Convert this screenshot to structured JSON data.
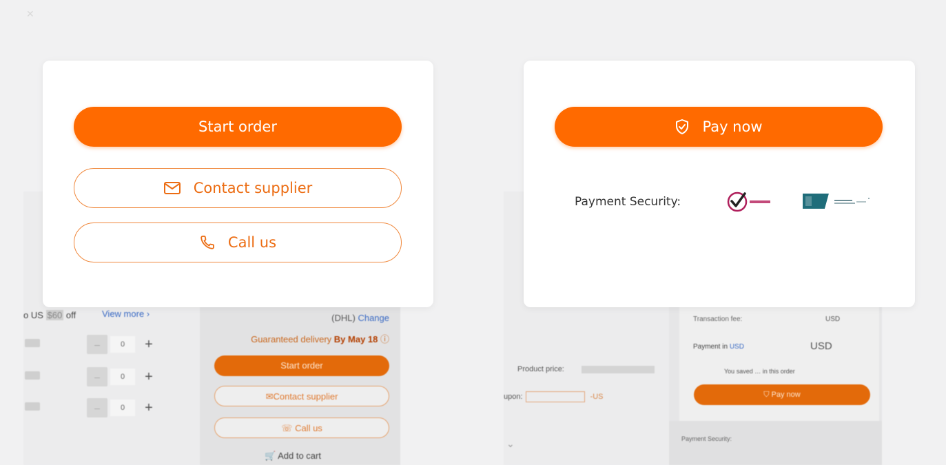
{
  "left_card": {
    "start_order_label": "Start order",
    "contact_supplier_label": "Contact supplier",
    "call_us_label": "Call us"
  },
  "right_card": {
    "pay_now_label": "Pay now",
    "payment_security_label": "Payment Security:"
  },
  "background_left": {
    "discount_text": "o US",
    "discount_amount": "$60",
    "discount_suffix": " off",
    "view_more": "View more",
    "quantities": [
      "0",
      "0",
      "0"
    ],
    "shipping_carrier": "(DHL)",
    "change_link": "Change",
    "guaranteed_text": "Guaranteed delivery",
    "guaranteed_date": "By May 18",
    "start_order": "Start order",
    "contact_supplier": "Contact supplier",
    "call_us": "Call us",
    "add_to_cart": "Add to cart"
  },
  "background_right": {
    "product_price_label": "Product price:",
    "coupon_label": "upon:",
    "coupon_minus": "-US",
    "transaction_fee_label": "Transaction fee:",
    "transaction_fee_currency": "USD",
    "payment_in_label": "Payment in",
    "payment_in_currency": "USD",
    "payment_total_currency": "USD",
    "saved_prefix": "You saved",
    "saved_suffix": "in this order",
    "pay_now": "Pay now",
    "payment_security": "Payment Security:"
  },
  "colors": {
    "accent": "#ff6a00",
    "accent_border": "#f0883c",
    "card_bg": "#ffffff",
    "page_bg": "#f1f1f2"
  },
  "icons": {
    "contact": "envelope-icon",
    "call": "phone-icon",
    "pay": "shield-check-icon"
  }
}
